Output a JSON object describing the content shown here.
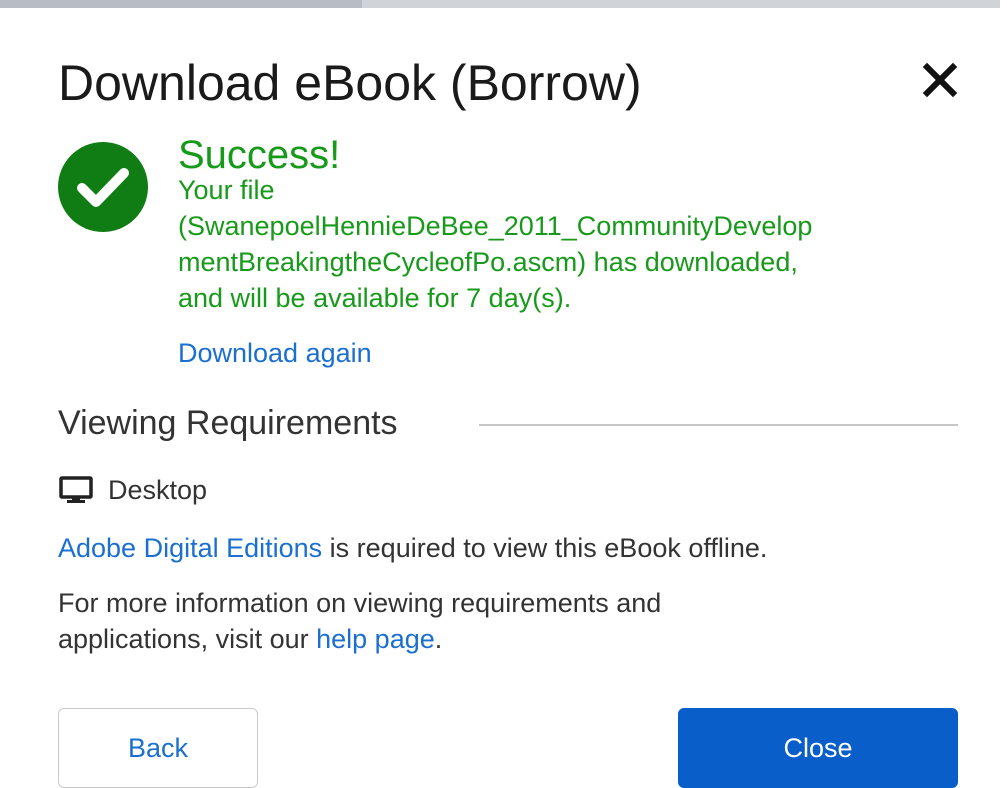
{
  "dialog": {
    "title": "Download eBook (Borrow)",
    "close_icon": "close-icon"
  },
  "success": {
    "icon": "check-circle-icon",
    "heading": "Success!",
    "lines": [
      "Your file",
      "(SwanepoelHennieDeBee_2011_CommunityDevelop",
      "mentBreakingtheCycleofPo.ascm) has downloaded,",
      "and will be available for 7 day(s)."
    ],
    "download_again_label": "Download again"
  },
  "requirements": {
    "heading": "Viewing Requirements",
    "platform_icon": "desktop-monitor-icon",
    "platform_label": "Desktop",
    "app_link_label": "Adobe Digital Editions",
    "app_text": " is required to view this eBook offline.",
    "info_line1": "For more information on viewing requirements and",
    "info_line2_prefix": "applications, visit our ",
    "help_link_label": "help page",
    "info_line2_suffix": "."
  },
  "buttons": {
    "back_label": "Back",
    "close_label": "Close"
  },
  "colors": {
    "success_green": "#179a1a",
    "link_blue": "#1a6fd1",
    "primary_button": "#0a5ec9",
    "check_circle": "#0f7d13"
  }
}
